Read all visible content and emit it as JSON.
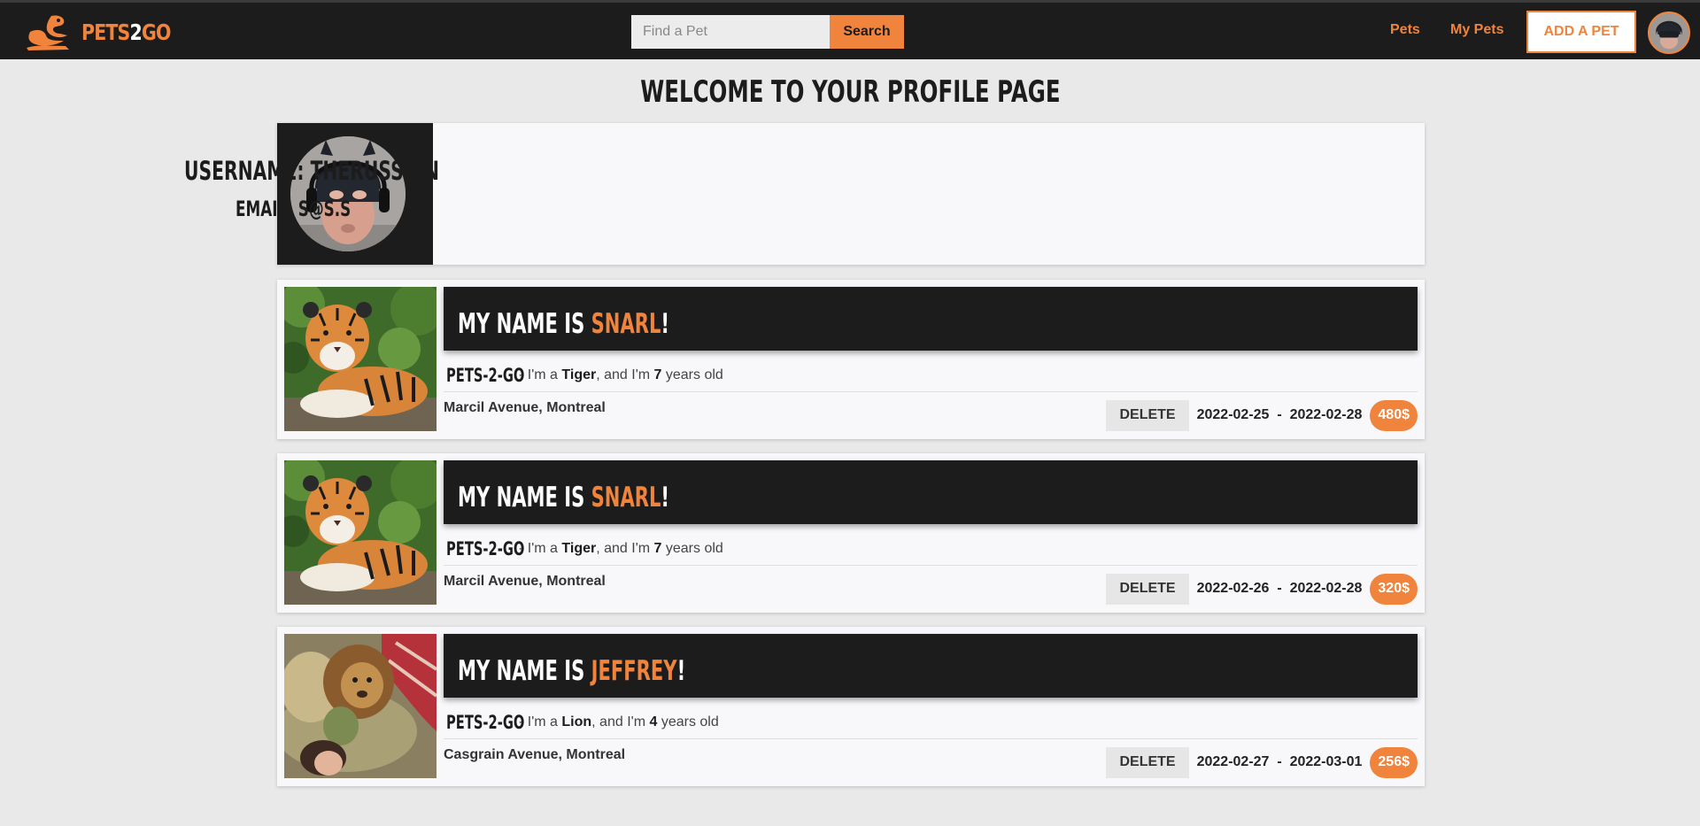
{
  "navbar": {
    "logo": {
      "text_main": "PETS",
      "text_num": "2",
      "text_end": "GO",
      "icon": "pet-logo-icon"
    },
    "search": {
      "placeholder": "Find a Pet",
      "value": "",
      "button_label": "Search"
    },
    "links": {
      "pets": "Pets",
      "my_pets": "My Pets"
    },
    "add_pet_label": "ADD A PET",
    "avatar_icon": "user-avatar"
  },
  "page": {
    "title": "Welcome to your profile page"
  },
  "profile": {
    "username_label": "Username:",
    "username": "TheRussian",
    "email_label": "Email:",
    "email": "s@s.s"
  },
  "pets": [
    {
      "banner_prefix": "My name is ",
      "name": "Snarl",
      "banner_suffix": "!",
      "brand": "PETS-2-GO",
      "desc_intro": "- I'm a ",
      "species": "Tiger",
      "desc_mid": ", and I'm ",
      "age": "7",
      "desc_end": " years old",
      "location": "Marcil Avenue, Montreal",
      "delete_label": "DELETE",
      "start_date": "2022-02-25",
      "date_sep": "-",
      "end_date": "2022-02-28",
      "price": "480$",
      "photo": "tiger-photo"
    },
    {
      "banner_prefix": "My name is ",
      "name": "Snarl",
      "banner_suffix": "!",
      "brand": "PETS-2-GO",
      "desc_intro": "- I'm a ",
      "species": "Tiger",
      "desc_mid": ", and I'm ",
      "age": "7",
      "desc_end": " years old",
      "location": "Marcil Avenue, Montreal",
      "delete_label": "DELETE",
      "start_date": "2022-02-26",
      "date_sep": "-",
      "end_date": "2022-02-28",
      "price": "320$",
      "photo": "tiger-photo"
    },
    {
      "banner_prefix": "My name is ",
      "name": "Jeffrey",
      "banner_suffix": "!",
      "brand": "PETS-2-GO",
      "desc_intro": "- I'm a ",
      "species": "Lion",
      "desc_mid": ", and I'm ",
      "age": "4",
      "desc_end": " years old",
      "location": "Casgrain Avenue, Montreal",
      "delete_label": "DELETE",
      "start_date": "2022-02-27",
      "date_sep": "-",
      "end_date": "2022-03-01",
      "price": "256$",
      "photo": "lion-photo"
    }
  ],
  "colors": {
    "accent": "#f0843c",
    "dark": "#1c1c1c",
    "page_bg": "#e9e9e9",
    "card_bg": "#f8f8fb"
  }
}
